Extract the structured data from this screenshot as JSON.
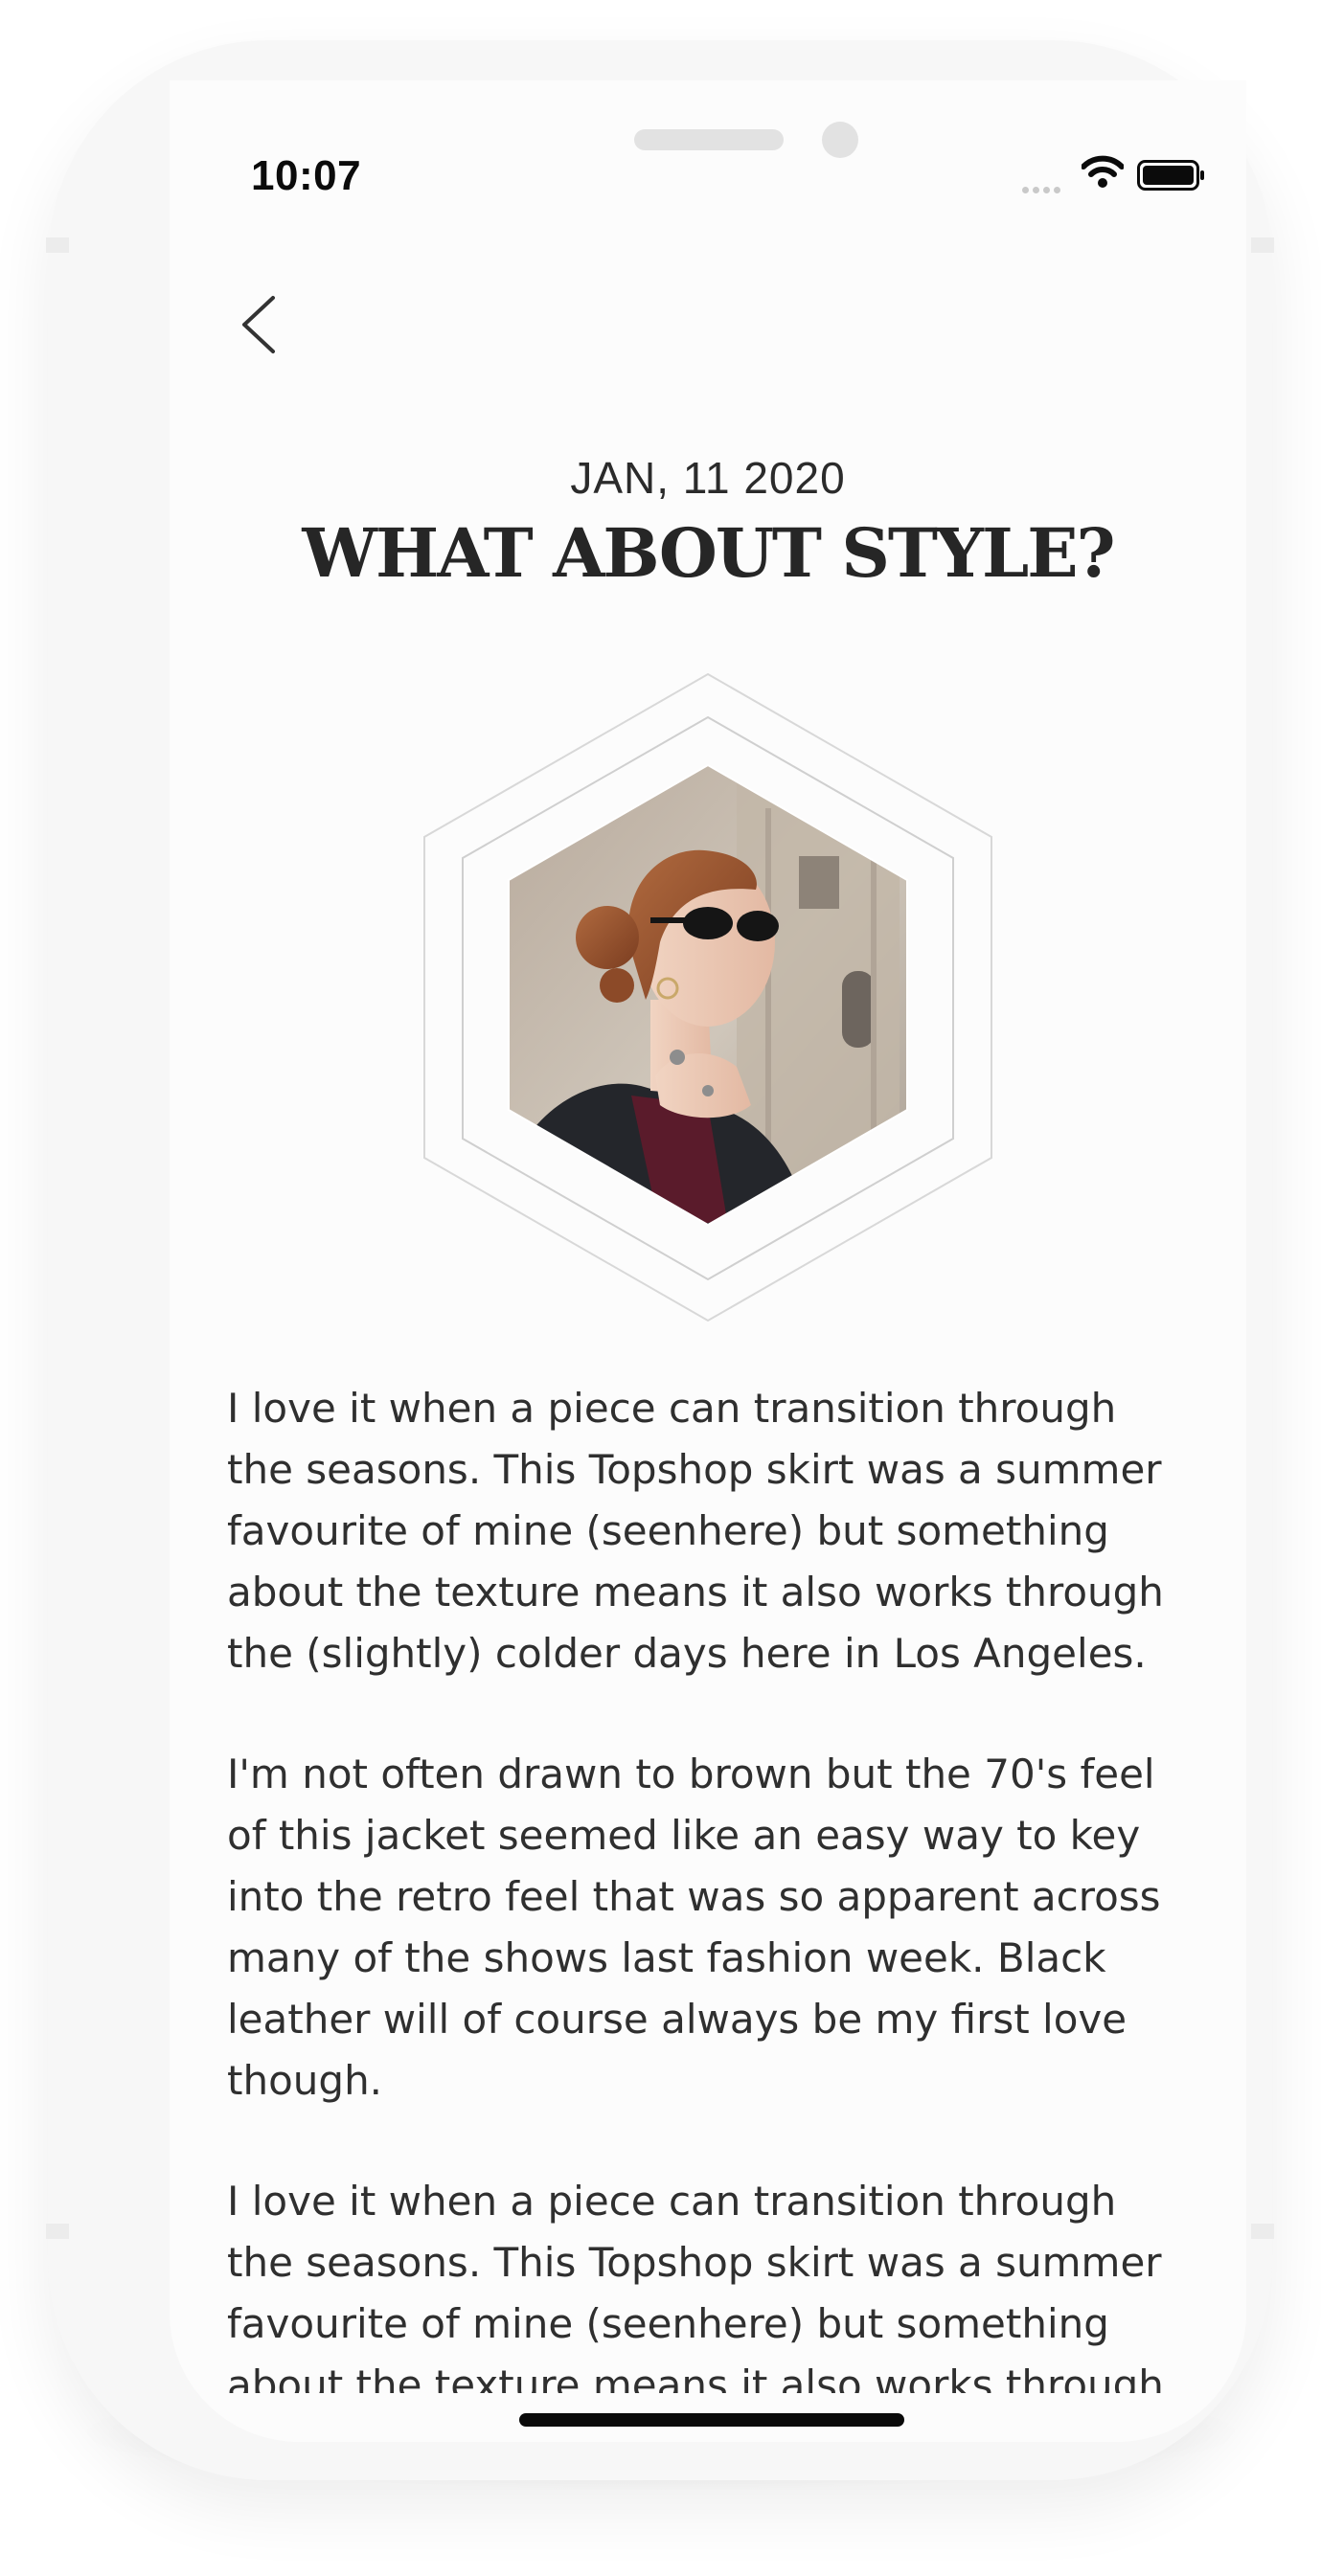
{
  "status_bar": {
    "time": "10:07",
    "icons": [
      "signal-icon",
      "wifi-icon",
      "battery-icon"
    ]
  },
  "nav": {
    "back_icon": "chevron-left-icon"
  },
  "article": {
    "date": "JAN, 11 2020",
    "title": "WHAT ABOUT STYLE?",
    "image": "hexagon-framed photo of woman in sunglasses",
    "paragraphs": [
      "I love it when a piece can transition through the seasons. This Topshop skirt was a summer favourite of mine (seenhere) but something about the texture means it also works through the (slightly) colder days here in Los Angeles.",
      "I'm not often drawn to brown but the 70's feel of this jacket seemed like an easy way to key into the retro feel that was so apparent across many of the shows last fashion week. Black leather will of course always be my first love though.",
      "I love it when a piece can transition through the seasons. This Topshop skirt was a summer favourite of mine (seenhere) but something about the texture means it also works through"
    ]
  },
  "colors": {
    "text": "#2f2f2f",
    "title": "#262626",
    "background": "#fcfcfc",
    "device_frame": "#f7f7f7"
  }
}
